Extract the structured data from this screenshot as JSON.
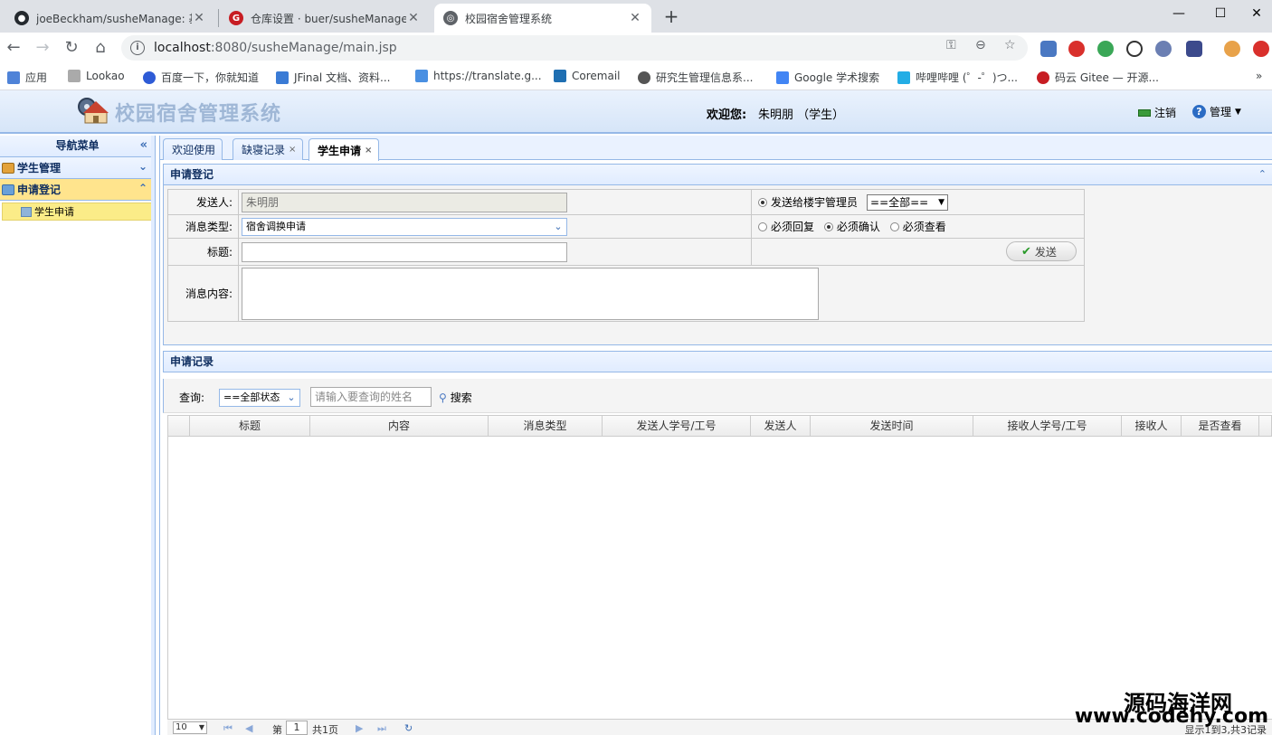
{
  "browser": {
    "tabs": [
      {
        "title": "joeBeckham/susheManage: 基",
        "active": false
      },
      {
        "title": "仓库设置 · buer/susheManage",
        "active": false
      },
      {
        "title": "校园宿舍管理系统",
        "active": true
      }
    ],
    "url_host": "localhost",
    "url_path": ":8080/susheManage/main.jsp",
    "bookmarks": [
      "应用",
      "Lookao",
      "百度一下，你就知道",
      "JFinal 文档、资料...",
      "https://translate.g...",
      "Coremail",
      "研究生管理信息系...",
      "Google 学术搜索",
      "哔哩哔哩 (゜-゜)つ...",
      "码云 Gitee — 开源..."
    ],
    "bookmarks_more": "»"
  },
  "app": {
    "title": "校园宿舍管理系统",
    "welcome_label": "欢迎您:",
    "username": "朱明朋 （学生）",
    "logout_label": "注销",
    "manage_label": "管理"
  },
  "nav": {
    "title": "导航菜单",
    "collapse_icon": "«",
    "sections": [
      {
        "label": "学生管理",
        "toggle": "⌄",
        "selected": false
      },
      {
        "label": "申请登记",
        "toggle": "⌃",
        "selected": true
      }
    ],
    "items": [
      {
        "label": "学生申请"
      }
    ]
  },
  "center_tabs": [
    {
      "label": "欢迎使用",
      "closable": false,
      "active": false
    },
    {
      "label": "缺寝记录",
      "closable": true,
      "active": false
    },
    {
      "label": "学生申请",
      "closable": true,
      "active": true
    }
  ],
  "form_panel": {
    "title": "申请登记",
    "sender_label": "发送人:",
    "sender_value": "朱明朋",
    "type_label": "消息类型:",
    "type_value": "宿舍调换申请",
    "title_label": "标题:",
    "title_value": "",
    "content_label": "消息内容:",
    "send_to_label": "发送给楼宇管理员",
    "building_select": "==全部==",
    "options": [
      {
        "label": "必须回复",
        "checked": false
      },
      {
        "label": "必须确认",
        "checked": true
      },
      {
        "label": "必须查看",
        "checked": false
      }
    ],
    "send_button": "发送"
  },
  "records_panel": {
    "title": "申请记录",
    "query_label": "查询:",
    "status_select": "==全部状态",
    "search_placeholder": "请输入要查询的姓名",
    "search_button": "搜索",
    "columns": [
      "标题",
      "内容",
      "消息类型",
      "发送人学号/工号",
      "发送人",
      "发送时间",
      "接收人学号/工号",
      "接收人",
      "是否查看"
    ],
    "rows": []
  },
  "pager": {
    "page_size": "10",
    "page_prefix": "第",
    "page_value": "1",
    "page_total": "共1页",
    "summary": "显示1到3,共3记录"
  },
  "watermark": {
    "line1": "源码海洋网",
    "line2": "www.codehy.com"
  }
}
